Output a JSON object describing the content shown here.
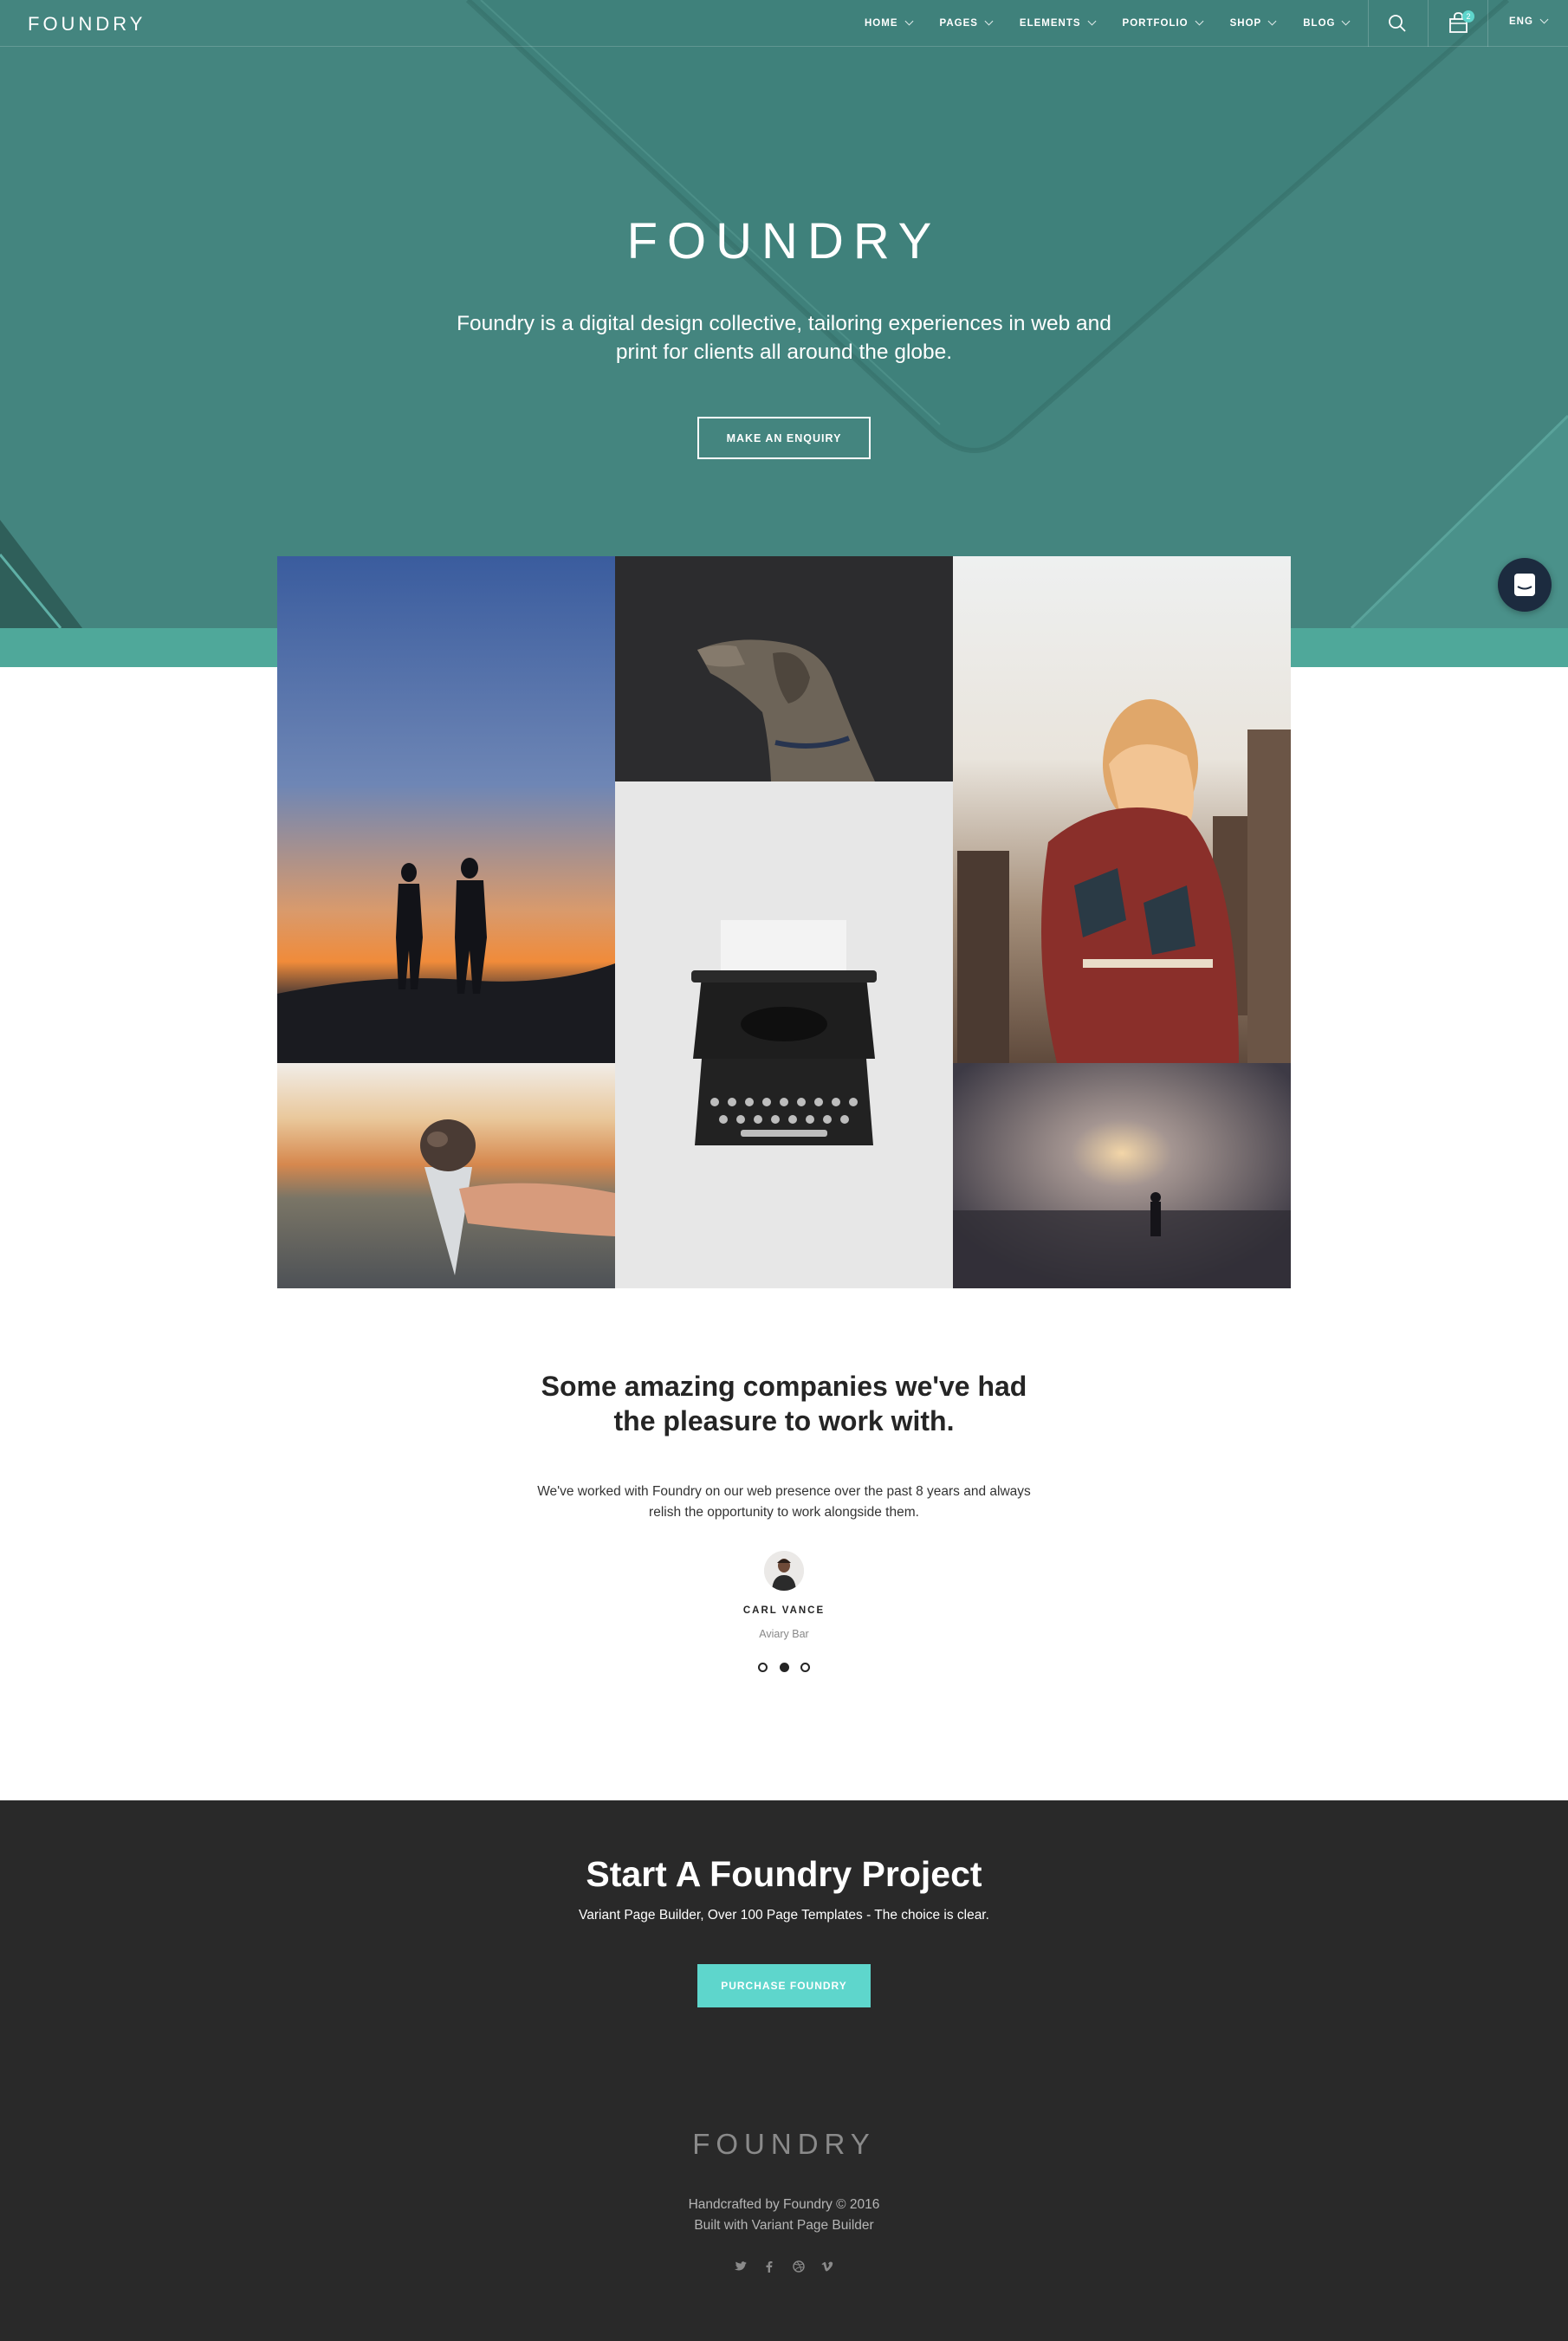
{
  "brand": "FOUNDRY",
  "nav": {
    "items": [
      {
        "label": "HOME"
      },
      {
        "label": "PAGES"
      },
      {
        "label": "ELEMENTS"
      },
      {
        "label": "PORTFOLIO"
      },
      {
        "label": "SHOP"
      },
      {
        "label": "BLOG"
      }
    ],
    "cart_count": "2",
    "language": "ENG"
  },
  "hero": {
    "title": "FOUNDRY",
    "subtitle": "Foundry is a digital design collective, tailoring experiences in web and print for clients all around the globe.",
    "button": "MAKE AN ENQUIRY"
  },
  "testimonial": {
    "title": "Some amazing companies we've had the pleasure to work with.",
    "quote": "We've worked with Foundry on our web presence over the past 8 years and always relish the opportunity to work alongside them.",
    "author": "CARL VANCE",
    "company": "Aviary Bar",
    "active_slide": 2,
    "slide_count": 3
  },
  "cta": {
    "title": "Start A Foundry Project",
    "subtitle": "Variant Page Builder, Over 100 Page Templates - The choice is clear.",
    "button": "PURCHASE FOUNDRY"
  },
  "footer": {
    "logo": "FOUNDRY",
    "line1": "Handcrafted by Foundry © 2016",
    "line2": "Built with Variant Page Builder",
    "social": [
      "twitter-icon",
      "facebook-icon",
      "dribbble-icon",
      "vimeo-icon"
    ]
  },
  "colors": {
    "hero_bg": "#44857f",
    "accent": "#5ed6cc",
    "footer_bg": "#292929",
    "chat_button": "#1c2b3f"
  }
}
